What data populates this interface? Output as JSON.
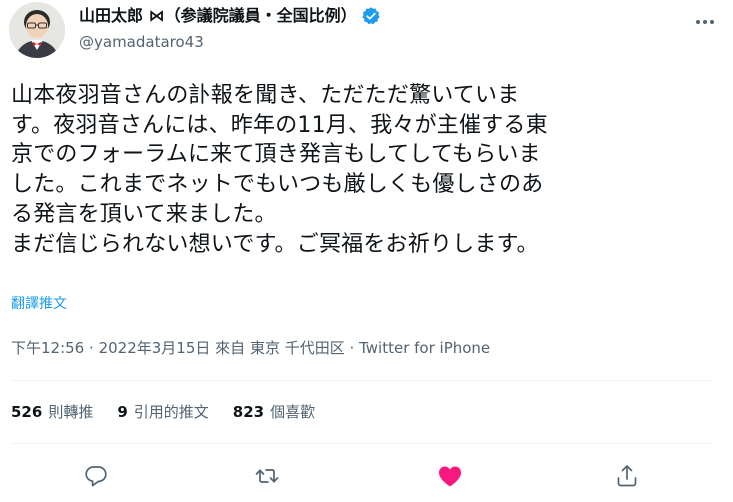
{
  "author": {
    "display_name": "山田太郎 ⋈（参議院議員・全国比例）",
    "handle": "@yamadataro43",
    "verified": true
  },
  "tweet": {
    "text": "山本夜羽音さんの訃報を聞き、ただただ驚いていま\nす。夜羽音さんには、昨年の11月、我々が主催する東\n京でのフォーラムに来て頂き発言もしてしてもらいま\nした。これまでネットでもいつも厳しくも優しさのあ\nる発言を頂いて来ました。\nまだ信じられない想いです。ご冥福をお祈りします。",
    "translate_label": "翻譯推文"
  },
  "meta": {
    "time": "下午12:56",
    "date": "2022年3月15日",
    "from_label": "來自",
    "location": "東京 千代田区",
    "source": "Twitter for iPhone",
    "separator": "·"
  },
  "stats": {
    "retweets": {
      "count": "526",
      "label": "則轉推"
    },
    "quotes": {
      "count": "9",
      "label": "引用的推文"
    },
    "likes": {
      "count": "823",
      "label": "個喜歡"
    }
  },
  "colors": {
    "accent": "#1d9bf0",
    "like": "#f91880",
    "secondary_text": "#536471",
    "primary_text": "#0f1419",
    "divider": "#eff3f4"
  },
  "icons": {
    "more": "more-horizontal-icon",
    "verified": "verified-badge-icon",
    "reply": "reply-icon",
    "retweet": "retweet-icon",
    "like": "heart-filled-icon",
    "share": "share-icon"
  }
}
